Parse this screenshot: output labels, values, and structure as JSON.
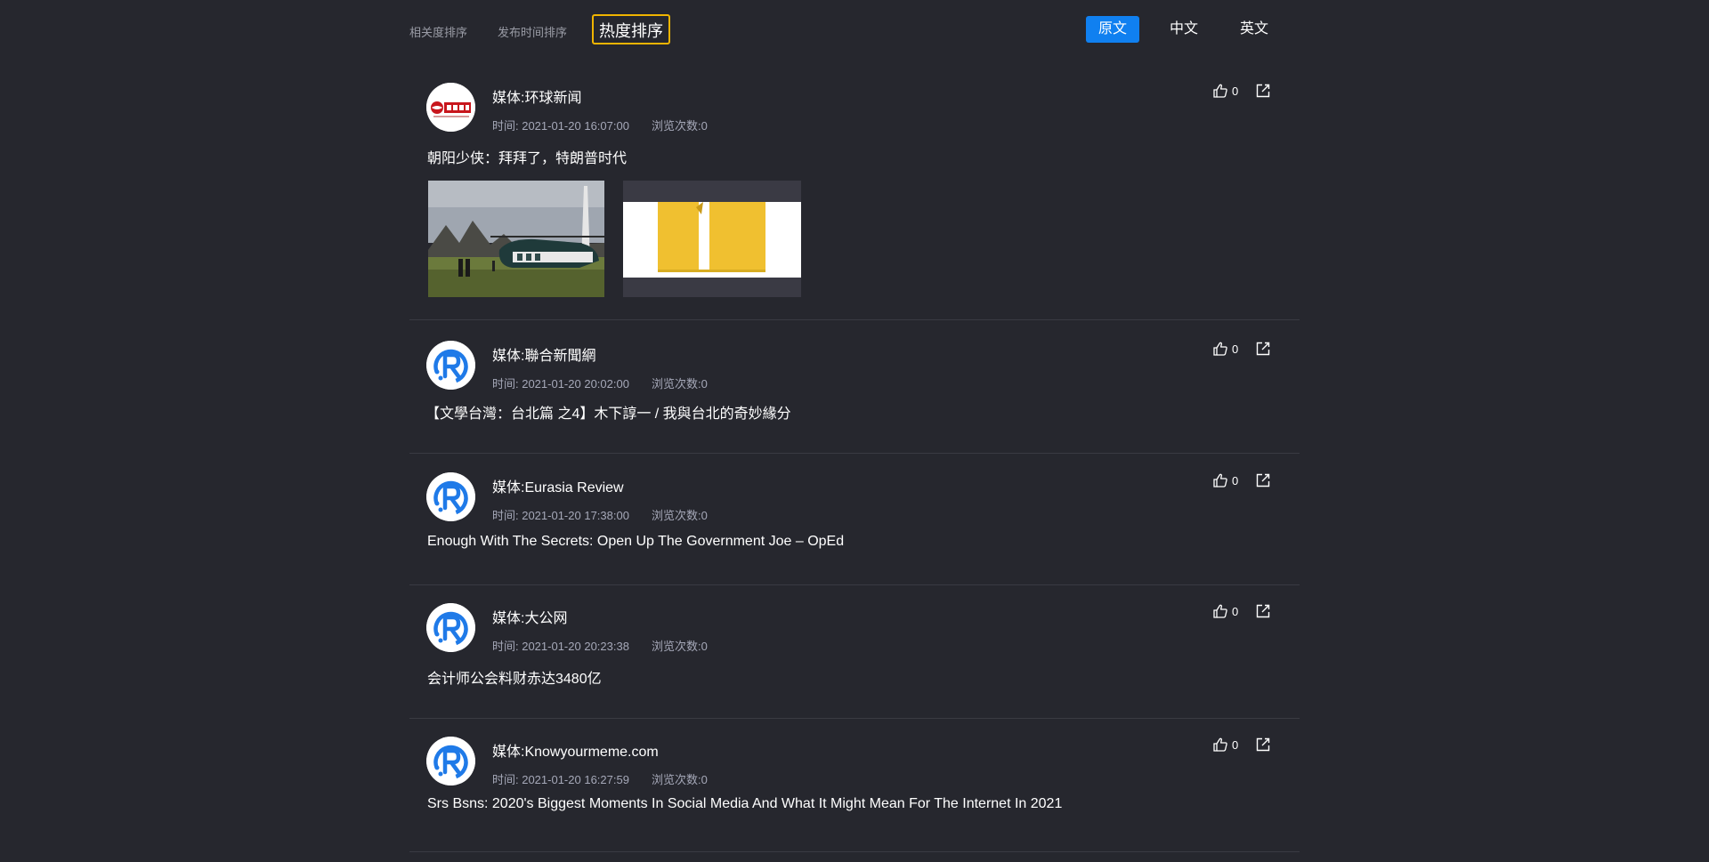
{
  "sort_tabs": [
    {
      "label": "相关度排序"
    },
    {
      "label": "发布时间排序"
    },
    {
      "label": "热度排序",
      "active": true
    }
  ],
  "languages": [
    {
      "label": "原文",
      "active": true
    },
    {
      "label": "中文"
    },
    {
      "label": "英文"
    }
  ],
  "items": [
    {
      "logo": "huanqiu-logo",
      "media": "媒体:环球新闻",
      "time": "时间: 2021-01-20 16:07:00",
      "views": "浏览次数:0",
      "title": "朝阳少侠：拜拜了，特朗普时代",
      "likes": "0",
      "has_images": true
    },
    {
      "logo": "default-r-logo",
      "media": "媒体:聯合新聞網",
      "time": "时间: 2021-01-20 20:02:00",
      "views": "浏览次数:0",
      "title": "【文學台灣：台北篇 之4】木下諄一 / 我與台北的奇妙緣分",
      "likes": "0"
    },
    {
      "logo": "default-r-logo",
      "media": "媒体:Eurasia Review",
      "time": "时间: 2021-01-20 17:38:00",
      "views": "浏览次数:0",
      "title": "Enough With The Secrets: Open Up The Government Joe – OpEd",
      "likes": "0"
    },
    {
      "logo": "default-r-logo",
      "media": "媒体:大公网",
      "time": "时间: 2021-01-20 20:23:38",
      "views": "浏览次数:0",
      "title": "会计师公会料财赤达3480亿",
      "likes": "0"
    },
    {
      "logo": "default-r-logo",
      "media": "媒体:Knowyourmeme.com",
      "time": "时间: 2021-01-20 16:27:59",
      "views": "浏览次数:0",
      "title": "Srs Bsns: 2020's Biggest Moments In Social Media And What It Might Mean For The Internet In 2021",
      "likes": "0"
    }
  ],
  "colors": {
    "background": "#26272e",
    "accent": "#1080f0",
    "highlight_border": "#f0b400",
    "logo_blue": "#1f7ae8",
    "huanqiu_red": "#c8161d"
  }
}
